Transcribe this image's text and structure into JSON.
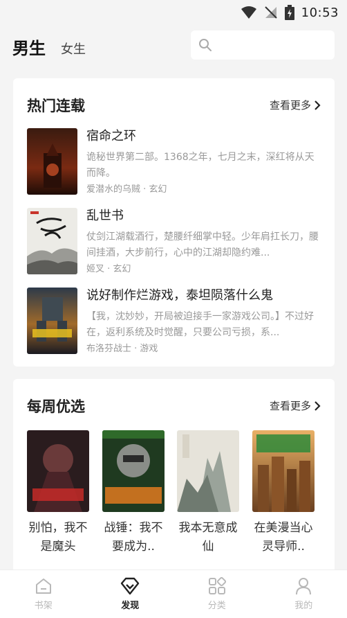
{
  "status": {
    "time": "10:53"
  },
  "header": {
    "tab_male": "男生",
    "tab_female": "女生"
  },
  "hot": {
    "title": "热门连载",
    "more": "查看更多",
    "books": [
      {
        "title": "宿命之环",
        "desc": "诡秘世界第二部。1368之年，七月之末，深红将从天而降。",
        "meta": "爱潜水的乌贼 · 玄幻",
        "cover_text": "宿命之环"
      },
      {
        "title": "乱世书",
        "desc": "仗剑江湖载酒行，楚腰纤细掌中轻。少年肩扛长刀，腰间挂酒，大步前行，心中的江湖却隐约难...",
        "meta": "姬叉 · 玄幻",
        "cover_text": "乱世书"
      },
      {
        "title": "说好制作烂游戏，泰坦陨落什么鬼",
        "desc": "【我，沈妙妙，开局被迫接手一家游戏公司。】不过好在，返利系统及时觉醒，只要公司亏损，系...",
        "meta": "布洛芬战士 · 游戏",
        "cover_text": "说好制作烂游戏 泰坦陨落什么鬼"
      }
    ]
  },
  "weekly": {
    "title": "每周优选",
    "more": "查看更多",
    "books": [
      {
        "title": "别怕，我不是魔头",
        "cover_text": "我不是魔头"
      },
      {
        "title": "战锤：我不要成为..",
        "cover_text": "我不要成为臭罐头啊"
      },
      {
        "title": "我本无意成仙",
        "cover_text": "無意成仙"
      },
      {
        "title": "在美漫当心灵导师..",
        "cover_text": "在美漫当心灵导师的日子"
      }
    ]
  },
  "nav": [
    {
      "label": "书架",
      "icon": "house-icon"
    },
    {
      "label": "发现",
      "icon": "discover-icon"
    },
    {
      "label": "分类",
      "icon": "category-icon"
    },
    {
      "label": "我的",
      "icon": "person-icon"
    }
  ],
  "colors": {
    "active": "#222222",
    "inactive": "#b8b8b8",
    "background": "#f4f4f4"
  }
}
